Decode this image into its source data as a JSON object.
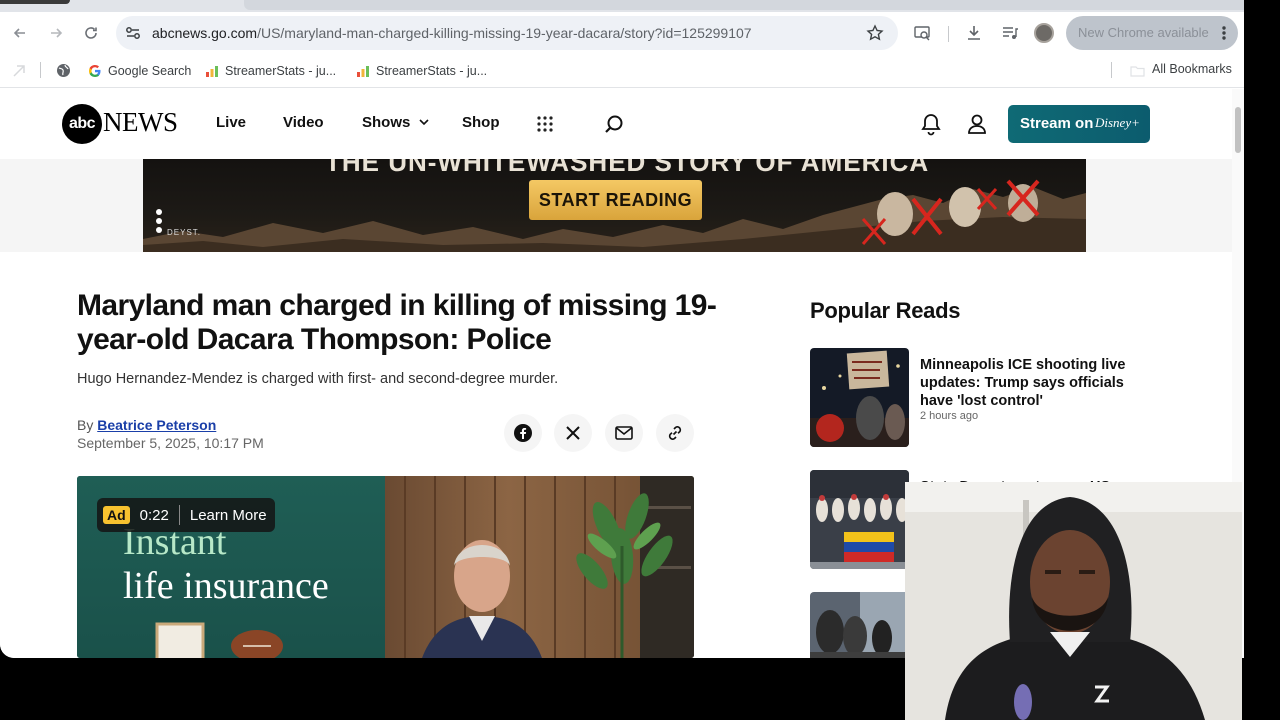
{
  "browser": {
    "url_domain": "abcnews.go.com",
    "url_path": "/US/maryland-man-charged-killing-missing-19-year-dacara/story?id=125299107",
    "update_label": "New Chrome available",
    "bookmarks": [
      {
        "label": "Google Search",
        "icon": "google-icon"
      },
      {
        "label": "StreamerStats - ju...",
        "icon": "bar-chart-icon"
      },
      {
        "label": "StreamerStats - ju...",
        "icon": "bar-chart-icon"
      }
    ],
    "all_bookmarks": "All Bookmarks"
  },
  "site": {
    "logo_abc": "abc",
    "logo_news": "NEWS",
    "nav": [
      "Live",
      "Video",
      "Shows",
      "Shop"
    ],
    "stream_label": "Stream on",
    "stream_brand": "Disney+"
  },
  "banner": {
    "title": "THE UN-WHITEWASHED STORY OF AMERICA",
    "cta": "START READING",
    "brand": "DEYST."
  },
  "article": {
    "headline": "Maryland man charged in killing of missing 19-year-old Dacara Thompson: Police",
    "subhead": "Hugo Hernandez-Mendez is charged with first- and second-degree murder.",
    "by": "By",
    "author": "Beatrice Peterson",
    "date": "September 5, 2025, 10:17 PM"
  },
  "video": {
    "ad_badge": "Ad",
    "ad_time": "0:22",
    "learn_more": "Learn More",
    "ad_line1": "Instant",
    "ad_line2": "life insurance"
  },
  "popular": {
    "title": "Popular Reads",
    "items": [
      {
        "headline": "Minneapolis ICE shooting live updates: Trump says officials have 'lost control'",
        "time": "2 hours ago"
      },
      {
        "headline": "State Department warns US",
        "time": ""
      },
      {
        "headline": "",
        "time": ""
      }
    ]
  },
  "colors": {
    "stream_button": "#0f6a75",
    "author_link": "#1a3fa8",
    "ad_badge": "#f7c22f"
  }
}
